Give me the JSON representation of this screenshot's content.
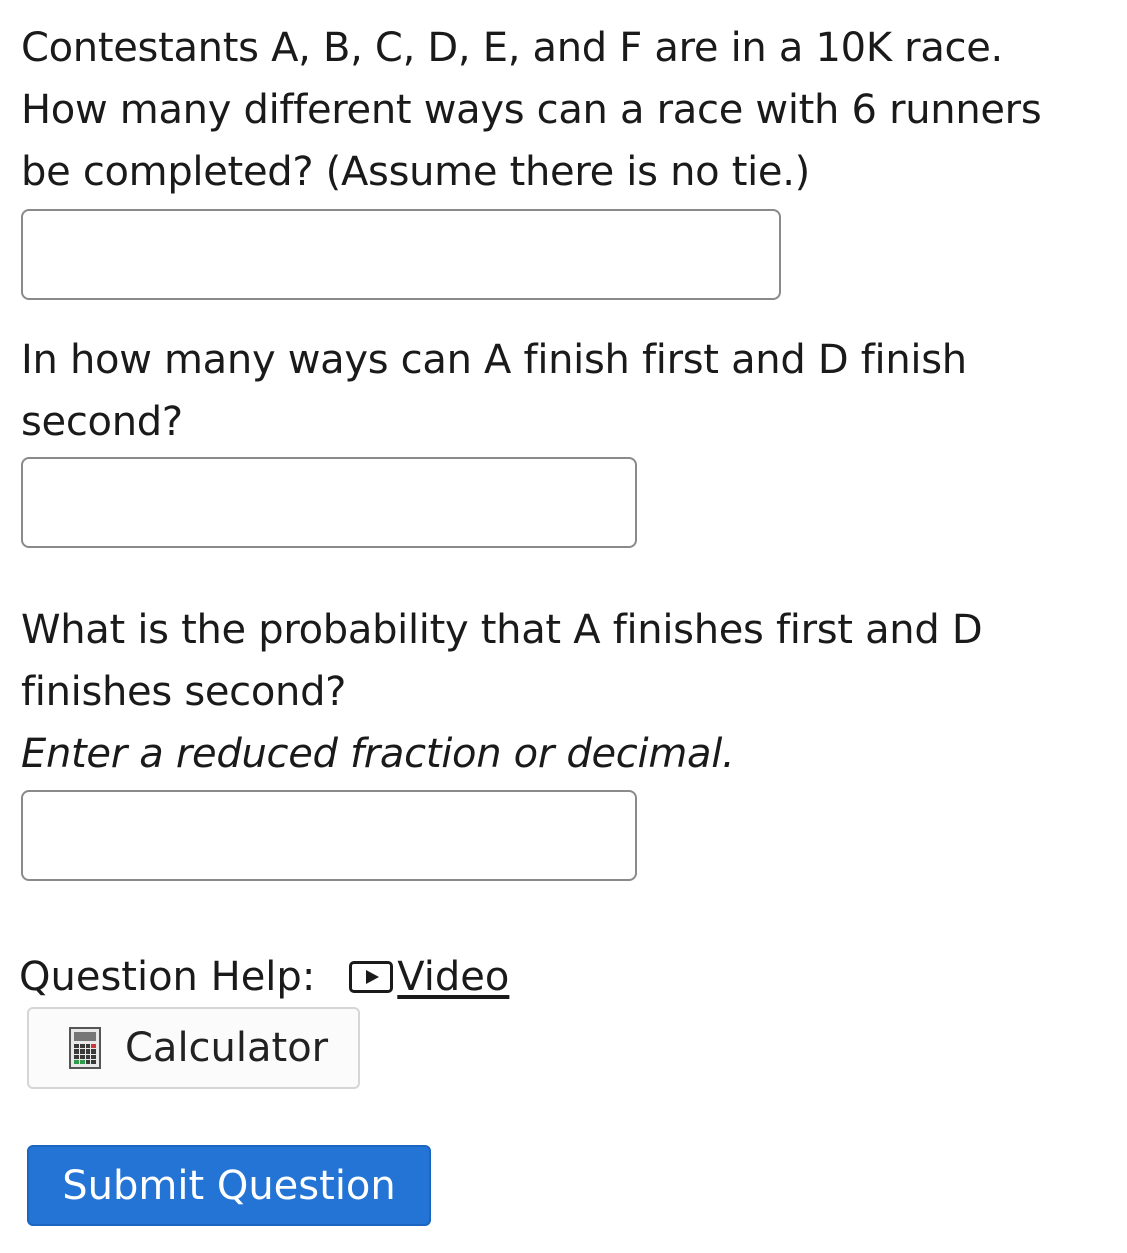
{
  "questions": [
    {
      "lines": [
        "Contestants A, B, C, D, E, and F are in a 10K race.",
        "How many different ways can a race with 6 runners",
        "be completed? (Assume there is no tie.)"
      ],
      "answer_value": ""
    },
    {
      "lines": [
        "In how many ways can A finish first and D finish",
        "second?"
      ],
      "answer_value": ""
    },
    {
      "lines": [
        "What is the probability that A finishes first and D",
        "finishes second?"
      ],
      "hint": "Enter a reduced fraction or decimal.",
      "answer_value": ""
    }
  ],
  "help": {
    "label": "Question Help:",
    "video_label": "Video",
    "calculator_label": "Calculator"
  },
  "submit_label": "Submit Question",
  "colors": {
    "submit_bg": "#2474d6",
    "input_border": "#8a8a8a"
  }
}
